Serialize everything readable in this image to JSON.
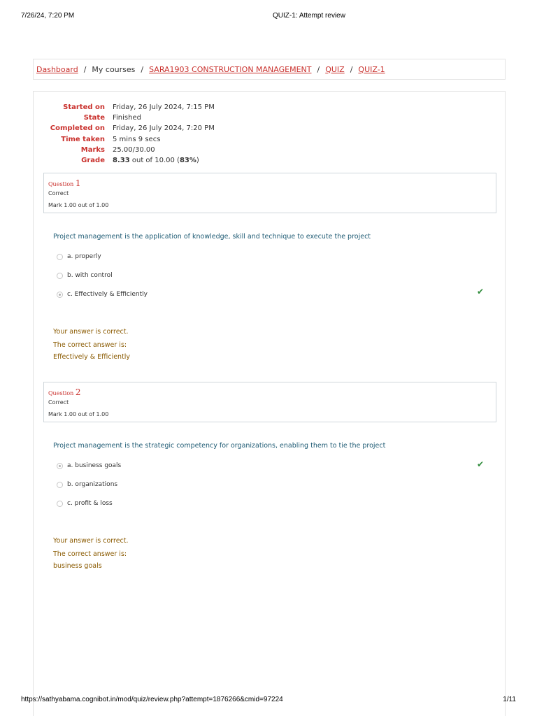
{
  "print_header": {
    "date": "7/26/24, 7:20 PM",
    "title": "QUIZ-1: Attempt review"
  },
  "breadcrumb": {
    "dashboard": "Dashboard",
    "my_courses": "My courses",
    "course": "SARA1903 CONSTRUCTION MANAGEMENT",
    "quiz": "QUIZ",
    "quiz1": "QUIZ-1",
    "separator": "/"
  },
  "summary": {
    "started_label": "Started on",
    "started_value": "Friday, 26 July 2024, 7:15 PM",
    "state_label": "State",
    "state_value": "Finished",
    "completed_label": "Completed on",
    "completed_value": "Friday, 26 July 2024, 7:20 PM",
    "time_label": "Time taken",
    "time_value": "5 mins 9 secs",
    "marks_label": "Marks",
    "marks_value": "25.00/30.00",
    "grade_label": "Grade",
    "grade_score": "8.33",
    "grade_mid": " out of 10.00 (",
    "grade_percent": "83%",
    "grade_end": ")"
  },
  "questions": [
    {
      "label": "Question",
      "number": "1",
      "state": "Correct",
      "mark": "Mark 1.00 out of 1.00",
      "text": "Project management is the application of knowledge, skill and technique to execute the project",
      "options": [
        "a. properly",
        "b. with control",
        "c. Effectively & Efficiently"
      ],
      "feedback_correct": "Your answer is correct.",
      "feedback_label": "The correct answer is:",
      "feedback_answer": "Effectively & Efficiently"
    },
    {
      "label": "Question",
      "number": "2",
      "state": "Correct",
      "mark": "Mark 1.00 out of 1.00",
      "text": "Project management is the strategic competency for organizations, enabling them to tie the project",
      "options": [
        "a. business goals",
        "b. organizations",
        "c. profit & loss"
      ],
      "feedback_correct": "Your answer is correct.",
      "feedback_label": "The correct answer is:",
      "feedback_answer": "business goals"
    }
  ],
  "icons": {
    "tick": "check-icon",
    "radio": "radio-icon"
  },
  "colors": {
    "accent": "#c9302c",
    "question_text": "#1d5a73",
    "feedback": "#8a5a00",
    "tick": "#2e8b3a"
  },
  "print_footer": {
    "url": "https://sathyabama.cognibot.in/mod/quiz/review.php?attempt=1876266&cmid=97224",
    "page": "1/11"
  }
}
